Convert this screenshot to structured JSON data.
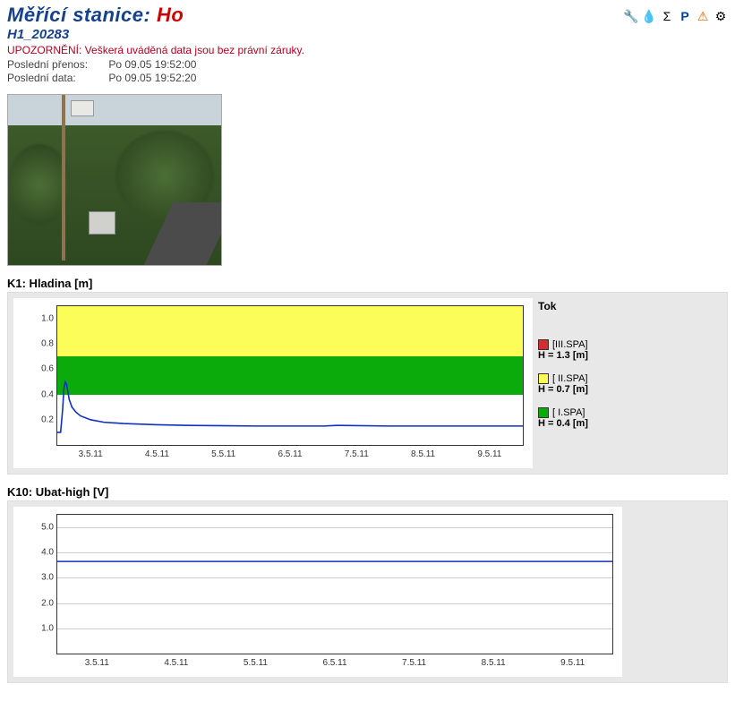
{
  "header": {
    "title_prefix": "Měřící stanice: ",
    "title_name": "Ho",
    "sub_id": "H1_20283",
    "warning": "UPOZORNĚNÍ: Veškerá uváděná data jsou bez právní záruky.",
    "last_transfer_label": "Poslední přenos:",
    "last_transfer_value": "Po 09.05 19:52:00",
    "last_data_label": "Poslední data:",
    "last_data_value": "Po 09.05 19:52:20"
  },
  "toolbar": {
    "icons": [
      "🔧",
      "💧",
      "Σ",
      "P",
      "⚠",
      "⚙"
    ]
  },
  "chart1": {
    "title": "K1: Hladina [m]",
    "legend_title": "Tok",
    "alarms": [
      {
        "name": "[III.SPA]",
        "value_label": "H = 1.3 [m]",
        "color": "#d12f2f",
        "threshold": 1.3
      },
      {
        "name": "[ II.SPA]",
        "value_label": "H = 0.7 [m]",
        "color": "#fdfd5a",
        "threshold": 0.7
      },
      {
        "name": "[  I.SPA]",
        "value_label": "H = 0.4 [m]",
        "color": "#0bab0b",
        "threshold": 0.4
      }
    ]
  },
  "chart2": {
    "title": "K10: Ubat-high [V]"
  },
  "chart_data": [
    {
      "type": "line",
      "title": "K1: Hladina [m]",
      "xlabel": "",
      "ylabel": "",
      "ylim": [
        0,
        1.1
      ],
      "y_ticks": [
        0.2,
        0.4,
        0.6,
        0.8,
        1.0
      ],
      "x_ticks": [
        "3.5.11",
        "4.5.11",
        "5.5.11",
        "6.5.11",
        "7.5.11",
        "8.5.11",
        "9.5.11"
      ],
      "bands": [
        {
          "from": 0.0,
          "to": 0.4,
          "color": "#ffffff"
        },
        {
          "from": 0.4,
          "to": 0.7,
          "color": "#0bab0b"
        },
        {
          "from": 0.7,
          "to": 1.1,
          "color": "#fdfd5a"
        }
      ],
      "series": [
        {
          "name": "Hladina",
          "x": [
            0.0,
            0.05,
            0.08,
            0.1,
            0.12,
            0.14,
            0.16,
            0.18,
            0.22,
            0.28,
            0.35,
            0.5,
            0.7,
            1.0,
            1.5,
            2.0,
            3.0,
            4.0,
            4.2,
            5.0,
            6.0,
            7.0
          ],
          "y": [
            0.1,
            0.1,
            0.28,
            0.45,
            0.5,
            0.48,
            0.42,
            0.36,
            0.3,
            0.26,
            0.23,
            0.2,
            0.18,
            0.17,
            0.16,
            0.155,
            0.15,
            0.15,
            0.155,
            0.15,
            0.15,
            0.15
          ]
        }
      ]
    },
    {
      "type": "line",
      "title": "K10: Ubat-high [V]",
      "xlabel": "",
      "ylabel": "",
      "ylim": [
        0.0,
        5.5
      ],
      "y_ticks": [
        1.0,
        2.0,
        3.0,
        4.0,
        5.0
      ],
      "x_ticks": [
        "3.5.11",
        "4.5.11",
        "5.5.11",
        "6.5.11",
        "7.5.11",
        "8.5.11",
        "9.5.11"
      ],
      "series": [
        {
          "name": "Ubat-high",
          "x": [
            0.0,
            7.0
          ],
          "y": [
            3.65,
            3.65
          ]
        }
      ]
    }
  ]
}
